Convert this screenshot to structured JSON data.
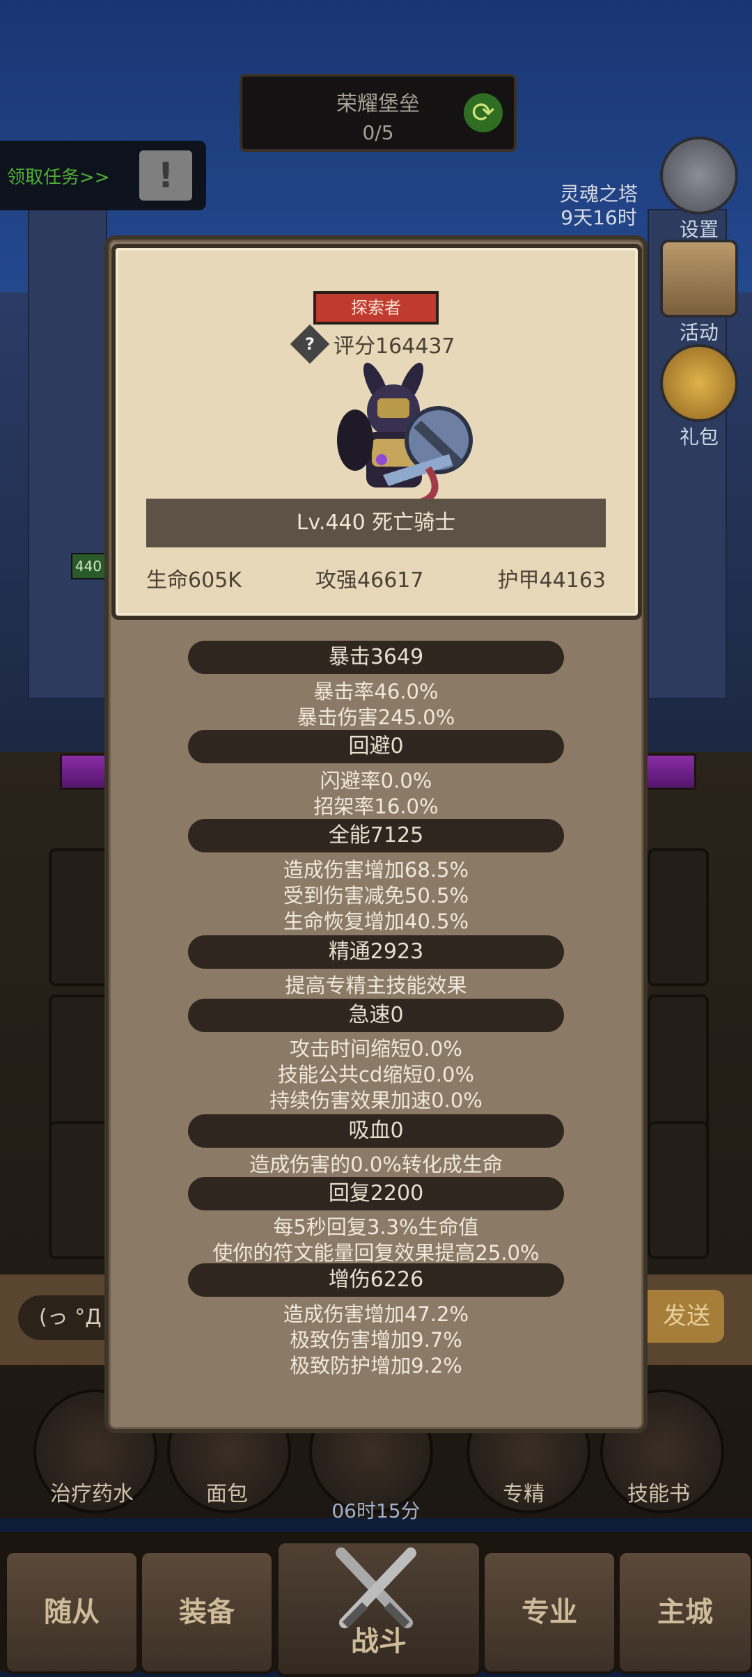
{
  "hud": {
    "quest_title": "荣耀堡垒",
    "quest_progress": "0/5",
    "task_text": "领取任务>>",
    "task_icon": "!",
    "tower_label": "灵魂之塔",
    "tower_timer": "9天16时",
    "settings_label": "设置",
    "activity_label": "活动",
    "gift_label": "礼包",
    "level_chip": "440"
  },
  "chat": {
    "input_text": "(っ °Д",
    "send_label": "发送"
  },
  "items": [
    {
      "label": "治疗药水"
    },
    {
      "label": "面包"
    },
    {
      "label": ""
    },
    {
      "label": "专精"
    },
    {
      "label": "技能书"
    }
  ],
  "timer": "06时15分",
  "nav": [
    "随从",
    "装备",
    "战斗",
    "专业",
    "主城"
  ],
  "card": {
    "title_badge": "探索者",
    "score": "评分164437",
    "name": "Lv.440 死亡骑士",
    "hp": "生命605K",
    "attack": "攻强46617",
    "armor": "护甲44163"
  },
  "sections": [
    {
      "title": "暴击3649",
      "lines": [
        "暴击率46.0%",
        "暴击伤害245.0%"
      ]
    },
    {
      "title": "回避0",
      "lines": [
        "闪避率0.0%",
        "招架率16.0%"
      ]
    },
    {
      "title": "全能7125",
      "lines": [
        "造成伤害增加68.5%",
        "受到伤害减免50.5%",
        "生命恢复增加40.5%"
      ]
    },
    {
      "title": "精通2923",
      "lines": [
        "提高专精主技能效果"
      ]
    },
    {
      "title": "急速0",
      "lines": [
        "攻击时间缩短0.0%",
        "技能公共cd缩短0.0%",
        "持续伤害效果加速0.0%"
      ]
    },
    {
      "title": "吸血0",
      "lines": [
        "造成伤害的0.0%转化成生命"
      ]
    },
    {
      "title": "回复2200",
      "lines": [
        "每5秒回复3.3%生命值",
        "使你的符文能量回复效果提高25.0%"
      ]
    },
    {
      "title": "增伤6226",
      "lines": [
        "造成伤害增加47.2%",
        "极致伤害增加9.7%",
        "极致防护增加9.2%"
      ]
    }
  ]
}
